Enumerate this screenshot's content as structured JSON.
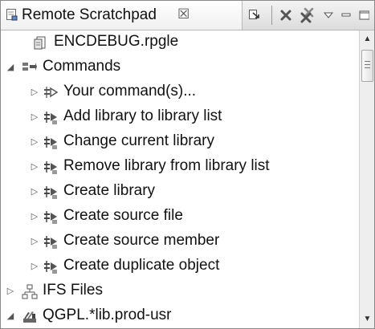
{
  "view": {
    "title": "Remote Scratchpad",
    "close_symbol": "☒",
    "toolbar": [
      {
        "name": "link-with-editor-icon"
      },
      {
        "name": "remove-icon"
      },
      {
        "name": "remove-all-icon"
      },
      {
        "name": "view-menu-icon"
      },
      {
        "name": "minimize-icon"
      },
      {
        "name": "maximize-icon"
      }
    ]
  },
  "tree": [
    {
      "label": "ENCDEBUG.rpgle",
      "level": 1,
      "twisty": "none",
      "icon": "source-member-icon"
    },
    {
      "label": "Commands",
      "level": 0,
      "twisty": "expanded",
      "icon": "commands-icon"
    },
    {
      "label": "Your command(s)...",
      "level": 1,
      "twisty": "collapsed",
      "icon": "command-icon"
    },
    {
      "label": "Add library to library list",
      "level": 1,
      "twisty": "collapsed",
      "icon": "command-run-icon"
    },
    {
      "label": "Change current library",
      "level": 1,
      "twisty": "collapsed",
      "icon": "command-run-icon"
    },
    {
      "label": "Remove library from library list",
      "level": 1,
      "twisty": "collapsed",
      "icon": "command-run-icon"
    },
    {
      "label": "Create library",
      "level": 1,
      "twisty": "collapsed",
      "icon": "command-run-icon"
    },
    {
      "label": "Create source file",
      "level": 1,
      "twisty": "collapsed",
      "icon": "command-run-icon"
    },
    {
      "label": "Create source member",
      "level": 1,
      "twisty": "collapsed",
      "icon": "command-run-icon"
    },
    {
      "label": "Create duplicate object",
      "level": 1,
      "twisty": "collapsed",
      "icon": "command-run-icon"
    },
    {
      "label": "IFS Files",
      "level": 0,
      "twisty": "collapsed",
      "icon": "ifs-files-icon"
    },
    {
      "label": "QGPL.*lib.prod-usr",
      "level": 0,
      "twisty": "expanded",
      "icon": "library-icon"
    }
  ],
  "scrollbar": {
    "position": 0.0
  }
}
